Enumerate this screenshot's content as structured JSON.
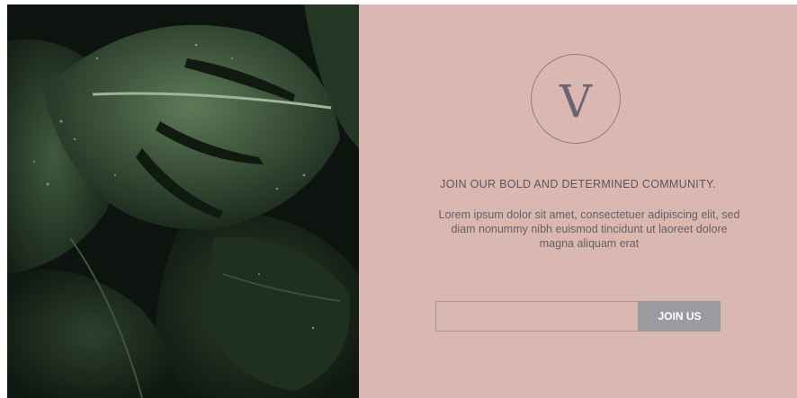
{
  "photo": {
    "alt": "monstera-leaves-photo"
  },
  "brand": {
    "monogram": "V"
  },
  "content": {
    "headline": "JOIN OUR BOLD AND DETERMINED COMMUNITY.",
    "body": "Lorem ipsum dolor sit amet, consectetuer adipiscing elit, sed diam nonummy nibh euismod tincidunt ut laoreet dolore magna aliquam erat"
  },
  "form": {
    "email_value": "",
    "email_placeholder": "",
    "button_label": "JOIN US"
  },
  "colors": {
    "panel_background": "#dbb7b2",
    "button_background": "#9c9a9e",
    "photo_background": "#0d130f"
  }
}
